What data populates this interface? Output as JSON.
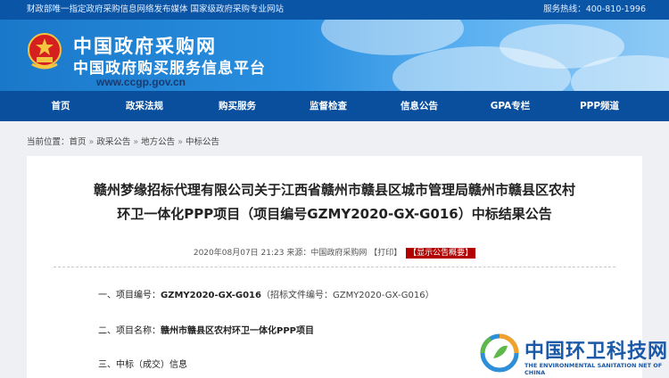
{
  "topbar": {
    "left_text": "财政部唯一指定政府采购信息网络发布媒体 国家级政府采购专业网站",
    "hotline_label": "服务热线：",
    "hotline_number": "400-810-1996"
  },
  "banner": {
    "title": "中国政府采购网",
    "subtitle": "中国政府购买服务信息平台",
    "url": "www.ccgp.gov.cn"
  },
  "nav": {
    "items": [
      {
        "label": "首页"
      },
      {
        "label": "政采法规"
      },
      {
        "label": "购买服务"
      },
      {
        "label": "监督检查"
      },
      {
        "label": "信息公告"
      },
      {
        "label": "GPA专栏"
      },
      {
        "label": "PPP频道"
      }
    ]
  },
  "breadcrumb": {
    "prefix": "当前位置：",
    "items": [
      "首页",
      "政采公告",
      "地方公告",
      "中标公告"
    ],
    "sep": "»"
  },
  "article": {
    "title_line1": "赣州梦缘招标代理有限公司关于江西省赣州市赣县区城市管理局赣州市赣县区农村",
    "title_line2": "环卫一体化PPP项目（项目编号GZMY2020-GX-G016）中标结果公告",
    "date": "2020年08月07日 21:23",
    "source": "来源：中国政府采购网",
    "print": "【打印】",
    "summary_button": "【显示公告概要】",
    "sections": [
      {
        "label": "一、项目编号：",
        "value": "GZMY2020-GX-G016",
        "extra": "（招标文件编号：GZMY2020-GX-G016）"
      },
      {
        "label": "二、项目名称：",
        "value": "赣州市赣县区农村环卫一体化PPP项目",
        "extra": ""
      },
      {
        "label": "三、中标（成交）信息",
        "value": "",
        "extra": ""
      }
    ]
  },
  "watermark": {
    "title": "中国环卫科技网",
    "subtitle": "THE ENVIRONMENTAL SANITATION NET OF CHINA"
  },
  "colors": {
    "topbar": "#0b55a6",
    "nav": "#0a4f9e",
    "accent_red": "#b30000",
    "watermark_blue": "#1a58a8"
  }
}
